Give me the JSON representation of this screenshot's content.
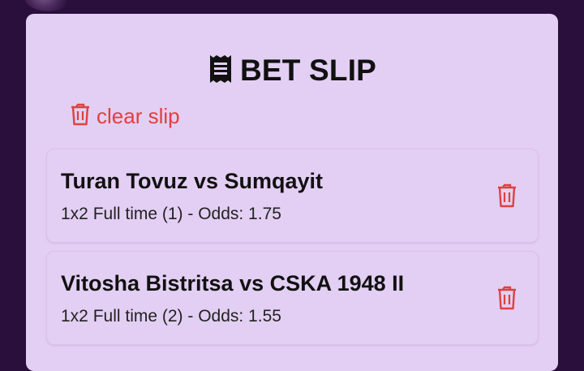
{
  "slip": {
    "title": "BET SLIP",
    "clear_label": "clear slip",
    "icons": {
      "header": "receipt-icon",
      "clear": "trash-icon",
      "remove": "trash-icon"
    },
    "accent_color": "#e0403f",
    "card_color": "#e3cff3",
    "background_color": "#2a0f3d"
  },
  "bets": [
    {
      "match": "Turan Tovuz vs Sumqayit",
      "details": "1x2 Full time (1) - Odds: 1.75"
    },
    {
      "match": "Vitosha Bistritsa vs CSKA 1948 II",
      "details": "1x2 Full time (2) - Odds: 1.55"
    }
  ]
}
